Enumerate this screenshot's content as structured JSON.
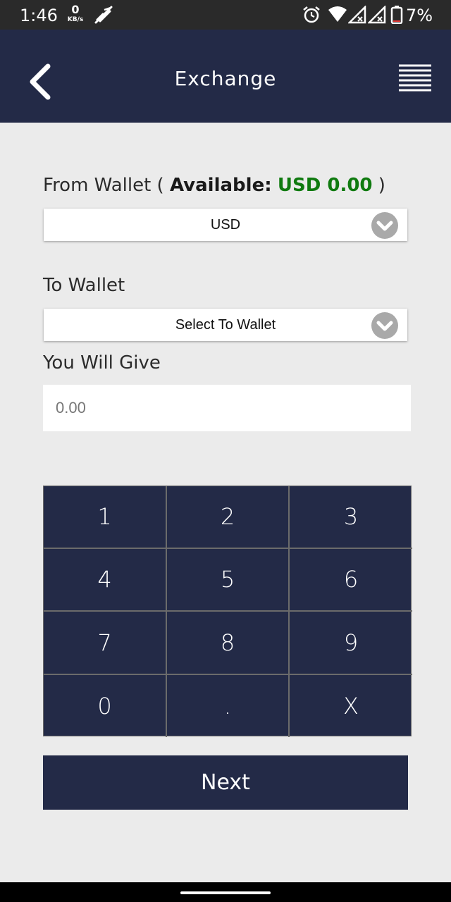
{
  "status_bar": {
    "time": "1:46",
    "net_speed_value": "0",
    "net_speed_unit": "KB/s",
    "battery": "7%"
  },
  "header": {
    "title": "Exchange"
  },
  "from_wallet": {
    "label_prefix": "From Wallet (",
    "available_label": "Available:",
    "available_value": "USD 0.00",
    "label_suffix": ")",
    "selected": "USD"
  },
  "to_wallet": {
    "label": "To Wallet",
    "selected": "Select To Wallet"
  },
  "give": {
    "label": "You Will Give",
    "placeholder": "0.00"
  },
  "keypad": {
    "keys": [
      "1",
      "2",
      "3",
      "4",
      "5",
      "6",
      "7",
      "8",
      "9",
      "0",
      ".",
      "X"
    ]
  },
  "next_button": "Next",
  "colors": {
    "primary": "#232a47",
    "available_green": "#0f7a0f",
    "background": "#ebebeb"
  }
}
